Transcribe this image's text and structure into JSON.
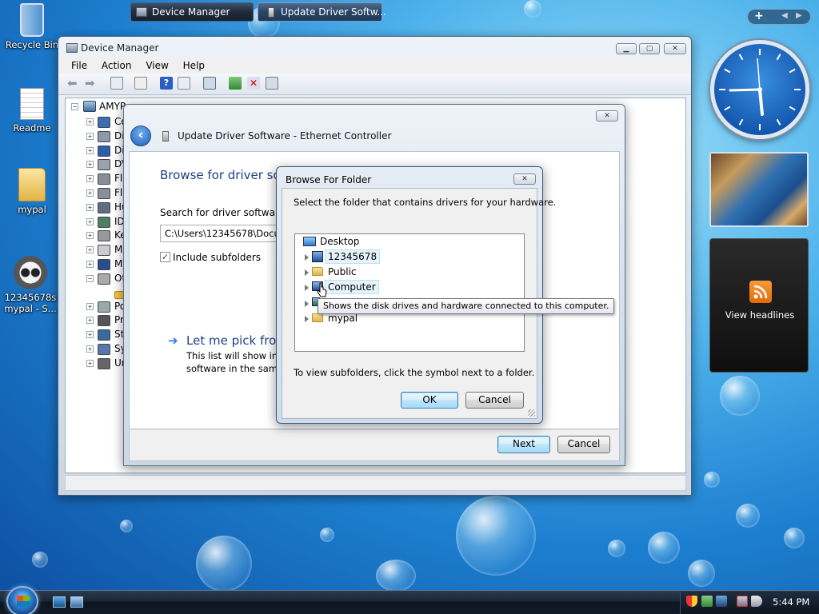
{
  "desktop": {
    "icons": [
      {
        "label": "Recycle Bin"
      },
      {
        "label": "Readme"
      },
      {
        "label": "mypal"
      },
      {
        "label": "12345678s mypal - S..."
      }
    ]
  },
  "device_manager": {
    "title": "Device Manager",
    "menu": [
      "File",
      "Action",
      "View",
      "Help"
    ],
    "tree_root": "AMYP",
    "tree_items": [
      "Co",
      "Di",
      "Di",
      "DV",
      "Flo",
      "Flo",
      "Hu",
      "ID",
      "Ke",
      "M",
      "M",
      "Ot",
      "",
      "Po",
      "Pr",
      "St",
      "Sy",
      "Un"
    ]
  },
  "update_driver": {
    "title": "Update Driver Software - Ethernet Controller",
    "heading": "Browse for driver sof",
    "search_label": "Search for driver software in",
    "path_value": "C:\\Users\\12345678\\Docum",
    "include_subfolders": "Include subfolders",
    "pick_heading": "Let me pick from",
    "pick_desc_1": "This list will show inst",
    "pick_desc_2": "software in the same",
    "next_label": "Next",
    "cancel_label": "Cancel"
  },
  "browse_folder": {
    "title": "Browse For Folder",
    "instruction": "Select the folder that contains drivers for your hardware.",
    "tree": [
      {
        "label": "Desktop",
        "level": 0
      },
      {
        "label": "12345678",
        "level": 1
      },
      {
        "label": "Public",
        "level": 1
      },
      {
        "label": "Computer",
        "level": 1
      },
      {
        "label": "",
        "level": 1
      },
      {
        "label": "mypal",
        "level": 1
      }
    ],
    "tooltip": "Shows the disk drives and hardware connected to this computer.",
    "hint": "To view subfolders, click the symbol next to a folder.",
    "ok_label": "OK",
    "cancel_label": "Cancel"
  },
  "sidebar": {
    "feed_label": "View headlines"
  },
  "taskbar": {
    "tasks": [
      "Device Manager",
      "Update Driver Softw..."
    ],
    "clock": "5:44 PM"
  },
  "colors": {
    "accent_link": "#1e5aa8",
    "heading_blue": "#1e3f86",
    "selection": "#cce8ff"
  }
}
